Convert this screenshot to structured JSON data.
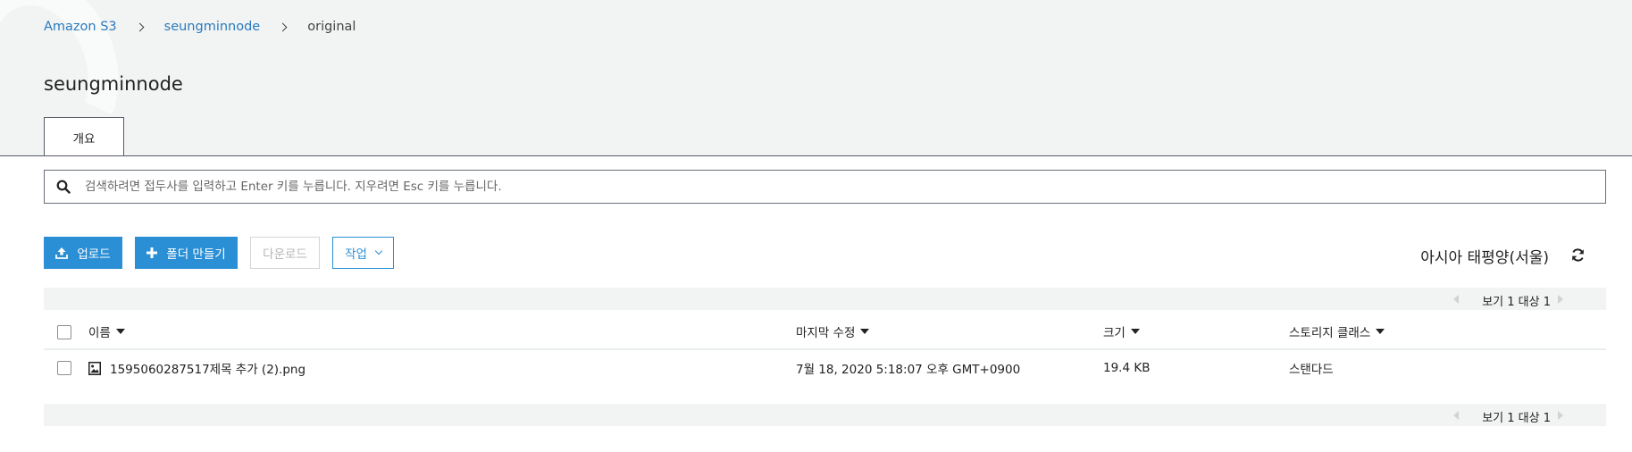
{
  "breadcrumb": {
    "items": [
      "Amazon S3",
      "seungminnode"
    ],
    "current": "original"
  },
  "page_title": "seungminnode",
  "tabs": [
    {
      "label": "개요",
      "active": true
    }
  ],
  "search": {
    "placeholder": "검색하려면 접두사를 입력하고 Enter 키를 누릅니다. 지우려면 Esc 키를 누릅니다.",
    "value": ""
  },
  "toolbar": {
    "upload_label": "업로드",
    "create_folder_label": "폴더 만들기",
    "download_label": "다운로드",
    "actions_label": "작업"
  },
  "region": "아시아 태평양(서울)",
  "pagination": {
    "text": "보기 1 대상 1"
  },
  "table": {
    "columns": [
      "이름",
      "마지막 수정",
      "크기",
      "스토리지 클래스"
    ],
    "rows": [
      {
        "name": "1595060287517제목 추가 (2).png",
        "modified": "7월 18, 2020 5:18:07 오후 GMT+0900",
        "size": "19.4 KB",
        "storage_class": "스탠다드"
      }
    ]
  },
  "icons": {
    "search": "search-icon",
    "upload": "upload-icon",
    "create_folder": "plus-icon",
    "actions": "chevron-down-icon",
    "refresh": "refresh-icon",
    "file": "image-file-icon",
    "sort": "caret-down-icon"
  },
  "colors": {
    "accent": "#2b8fd6",
    "link": "#2a7bbd",
    "header_bg": "#f2f3f3"
  }
}
